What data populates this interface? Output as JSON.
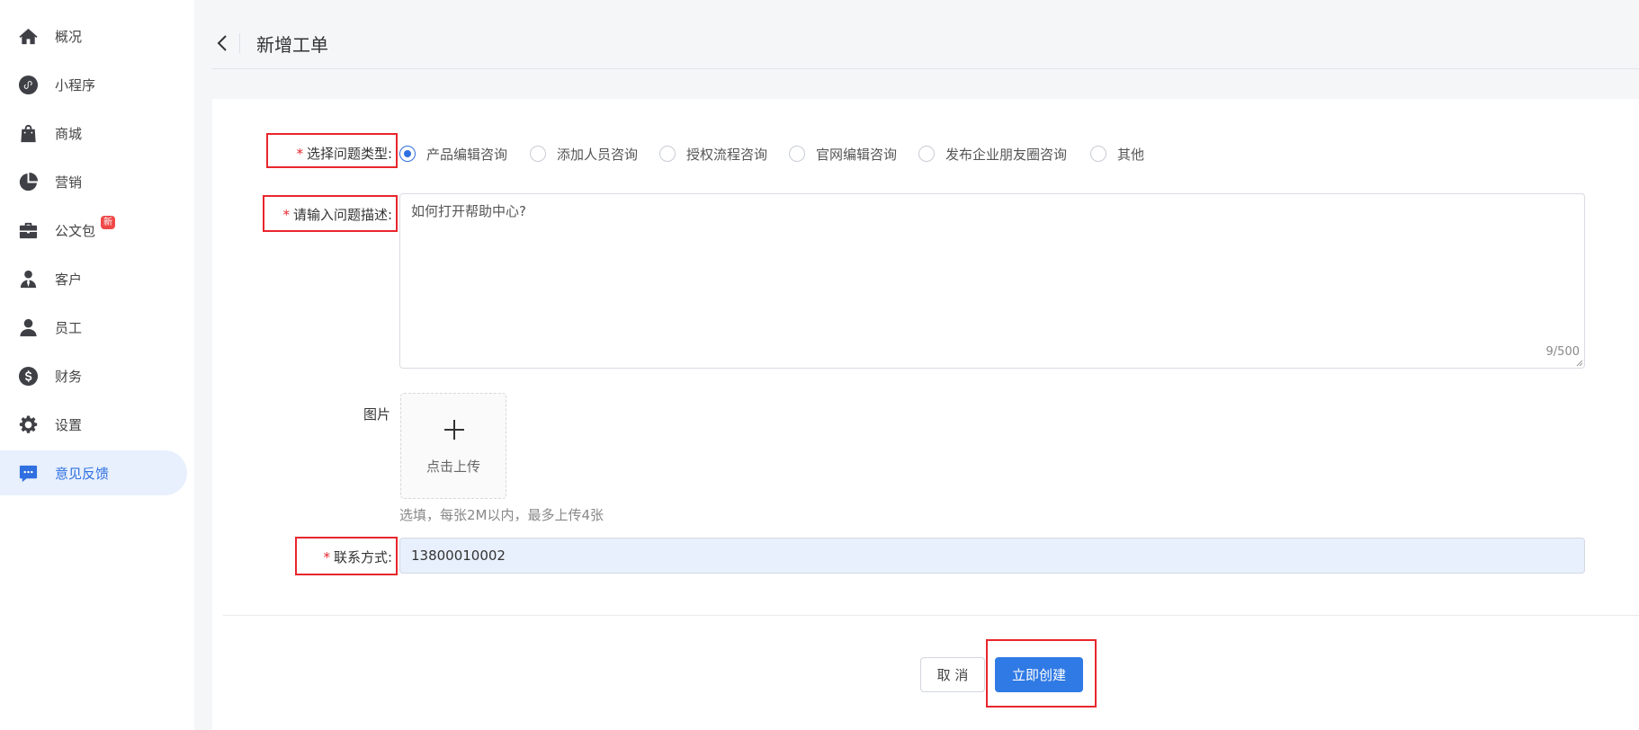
{
  "sidebar": {
    "items": [
      {
        "label": "概况",
        "icon": "home-icon"
      },
      {
        "label": "小程序",
        "icon": "mini-program-icon"
      },
      {
        "label": "商城",
        "icon": "shopping-bag-icon"
      },
      {
        "label": "营销",
        "icon": "pie-chart-icon"
      },
      {
        "label": "公文包",
        "icon": "briefcase-icon",
        "badge": "新"
      },
      {
        "label": "客户",
        "icon": "customer-icon"
      },
      {
        "label": "员工",
        "icon": "user-icon"
      },
      {
        "label": "财务",
        "icon": "dollar-icon"
      },
      {
        "label": "设置",
        "icon": "gear-icon"
      },
      {
        "label": "意见反馈",
        "icon": "feedback-icon",
        "active": true
      }
    ]
  },
  "header": {
    "title": "新增工单"
  },
  "form": {
    "issue_type": {
      "required_mark": "*",
      "label": "选择问题类型:",
      "options": [
        "产品编辑咨询",
        "添加人员咨询",
        "授权流程咨询",
        "官网编辑咨询",
        "发布企业朋友圈咨询",
        "其他"
      ],
      "selected": "产品编辑咨询"
    },
    "description": {
      "required_mark": "*",
      "label": "请输入问题描述:",
      "value": "如何打开帮助中心?",
      "counter": "9/500"
    },
    "image": {
      "label": "图片",
      "upload_text": "点击上传",
      "hint": "选填，每张2M以内，最多上传4张"
    },
    "contact": {
      "required_mark": "*",
      "label": "联系方式:",
      "value": "13800010002"
    }
  },
  "actions": {
    "cancel_label": "取 消",
    "create_label": "立即创建"
  },
  "colors": {
    "accent": "#2f7ae5",
    "highlight_box": "#e8262c",
    "required": "#e8262c"
  }
}
